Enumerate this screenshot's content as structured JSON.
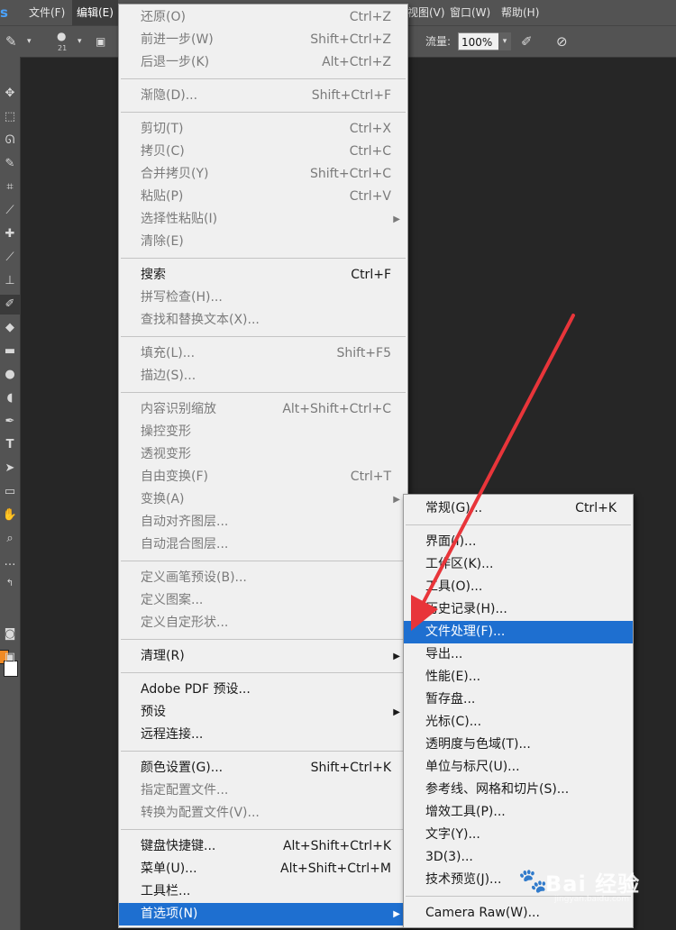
{
  "menubar": {
    "items": [
      "文件(F)",
      "编辑(E)",
      "视图(V)",
      "窗口(W)",
      "帮助(H)"
    ]
  },
  "options_bar": {
    "brush_size": "21",
    "flow_label": "流量:",
    "flow_value": "100%"
  },
  "edit_menu": {
    "items": [
      {
        "label": "还原(O)",
        "shortcut": "Ctrl+Z",
        "enabled": false
      },
      {
        "label": "前进一步(W)",
        "shortcut": "Shift+Ctrl+Z",
        "enabled": false
      },
      {
        "label": "后退一步(K)",
        "shortcut": "Alt+Ctrl+Z",
        "enabled": false
      },
      {
        "separator": true
      },
      {
        "label": "渐隐(D)...",
        "shortcut": "Shift+Ctrl+F",
        "enabled": false
      },
      {
        "separator": true
      },
      {
        "label": "剪切(T)",
        "shortcut": "Ctrl+X",
        "enabled": false
      },
      {
        "label": "拷贝(C)",
        "shortcut": "Ctrl+C",
        "enabled": false
      },
      {
        "label": "合并拷贝(Y)",
        "shortcut": "Shift+Ctrl+C",
        "enabled": false
      },
      {
        "label": "粘贴(P)",
        "shortcut": "Ctrl+V",
        "enabled": false
      },
      {
        "label": "选择性粘贴(I)",
        "submenu": true,
        "enabled": false
      },
      {
        "label": "清除(E)",
        "enabled": false
      },
      {
        "separator": true
      },
      {
        "label": "搜索",
        "shortcut": "Ctrl+F",
        "enabled": true
      },
      {
        "label": "拼写检查(H)...",
        "enabled": false
      },
      {
        "label": "查找和替换文本(X)...",
        "enabled": false
      },
      {
        "separator": true
      },
      {
        "label": "填充(L)...",
        "shortcut": "Shift+F5",
        "enabled": false
      },
      {
        "label": "描边(S)...",
        "enabled": false
      },
      {
        "separator": true
      },
      {
        "label": "内容识别缩放",
        "shortcut": "Alt+Shift+Ctrl+C",
        "enabled": false
      },
      {
        "label": "操控变形",
        "enabled": false
      },
      {
        "label": "透视变形",
        "enabled": false
      },
      {
        "label": "自由变换(F)",
        "shortcut": "Ctrl+T",
        "enabled": false
      },
      {
        "label": "变换(A)",
        "submenu": true,
        "enabled": false
      },
      {
        "label": "自动对齐图层...",
        "enabled": false
      },
      {
        "label": "自动混合图层...",
        "enabled": false
      },
      {
        "separator": true
      },
      {
        "label": "定义画笔预设(B)...",
        "enabled": false
      },
      {
        "label": "定义图案...",
        "enabled": false
      },
      {
        "label": "定义自定形状...",
        "enabled": false
      },
      {
        "separator": true
      },
      {
        "label": "清理(R)",
        "submenu": true,
        "enabled": true
      },
      {
        "separator": true
      },
      {
        "label": "Adobe PDF 预设...",
        "enabled": true
      },
      {
        "label": "预设",
        "submenu": true,
        "enabled": true
      },
      {
        "label": "远程连接...",
        "enabled": true
      },
      {
        "separator": true
      },
      {
        "label": "颜色设置(G)...",
        "shortcut": "Shift+Ctrl+K",
        "enabled": true
      },
      {
        "label": "指定配置文件...",
        "enabled": false
      },
      {
        "label": "转换为配置文件(V)...",
        "enabled": false
      },
      {
        "separator": true
      },
      {
        "label": "键盘快捷键...",
        "shortcut": "Alt+Shift+Ctrl+K",
        "enabled": true
      },
      {
        "label": "菜单(U)...",
        "shortcut": "Alt+Shift+Ctrl+M",
        "enabled": true
      },
      {
        "label": "工具栏...",
        "enabled": true
      },
      {
        "label": "首选项(N)",
        "submenu": true,
        "enabled": true,
        "highlighted": true
      }
    ]
  },
  "preferences_submenu": {
    "items": [
      {
        "label": "常规(G)...",
        "shortcut": "Ctrl+K"
      },
      {
        "separator": true
      },
      {
        "label": "界面(I)..."
      },
      {
        "label": "工作区(K)..."
      },
      {
        "label": "工具(O)..."
      },
      {
        "label": "历史记录(H)..."
      },
      {
        "label": "文件处理(F)...",
        "highlighted": true
      },
      {
        "label": "导出..."
      },
      {
        "label": "性能(E)..."
      },
      {
        "label": "暂存盘..."
      },
      {
        "label": "光标(C)..."
      },
      {
        "label": "透明度与色域(T)..."
      },
      {
        "label": "单位与标尺(U)..."
      },
      {
        "label": "参考线、网格和切片(S)..."
      },
      {
        "label": "增效工具(P)..."
      },
      {
        "label": "文字(Y)..."
      },
      {
        "label": "3D(3)..."
      },
      {
        "label": "技术预览(J)..."
      },
      {
        "separator": true
      },
      {
        "label": "Camera Raw(W)..."
      }
    ]
  },
  "watermark": {
    "text": "Bai 经验",
    "url": "jingyan.baidu.com"
  },
  "colors": {
    "highlight": "#1e6fd0",
    "annotation_arrow": "#e8353a",
    "foreground_swatch": "#f08a24",
    "background_swatch": "#ffffff"
  }
}
